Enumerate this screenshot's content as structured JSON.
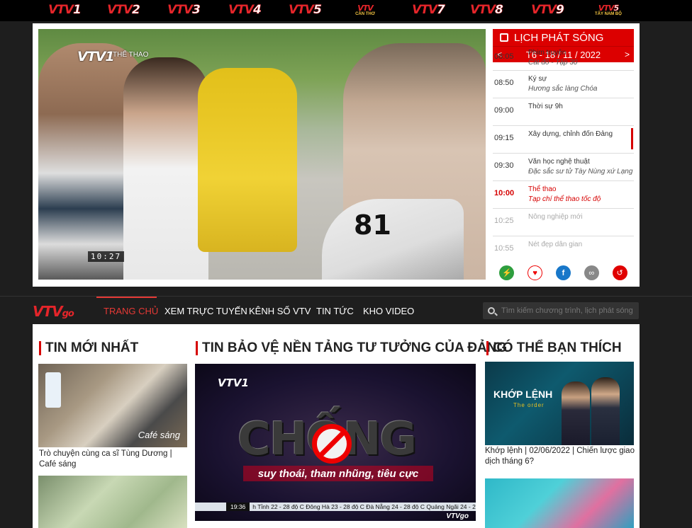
{
  "channels": [
    {
      "name": "VTV",
      "num": "1",
      "sub": ""
    },
    {
      "name": "VTV",
      "num": "2",
      "sub": ""
    },
    {
      "name": "VTV",
      "num": "3",
      "sub": ""
    },
    {
      "name": "VTV",
      "num": "4",
      "sub": ""
    },
    {
      "name": "VTV",
      "num": "5",
      "sub": ""
    },
    {
      "name": "VTV",
      "num": "",
      "sub": "CẦN THƠ"
    },
    {
      "name": "VTV",
      "num": "7",
      "sub": ""
    },
    {
      "name": "VTV",
      "num": "8",
      "sub": ""
    },
    {
      "name": "VTV",
      "num": "9",
      "sub": ""
    },
    {
      "name": "VTV",
      "num": "5",
      "sub": "TÂY NAM BỘ"
    }
  ],
  "player": {
    "logo": "VTV1",
    "logo_sub": "THỂ THAO",
    "time": "10:27",
    "car_number": "81"
  },
  "schedule": {
    "title": "LỊCH PHÁT SÓNG",
    "date": "T6 - 18 / 11 / 2022",
    "prev": "<",
    "next": ">",
    "items": [
      {
        "time": "08:05",
        "title": "Phim truyện",
        "sub": "Cát đỏ - Tập 30",
        "state": "past"
      },
      {
        "time": "08:50",
        "title": "Ký sự",
        "sub": "Hương sắc làng Chóa",
        "state": "past"
      },
      {
        "time": "09:00",
        "title": "Thời sự 9h",
        "sub": "",
        "state": "past"
      },
      {
        "time": "09:15",
        "title": "Xây dựng, chỉnh đốn Đảng",
        "sub": "",
        "state": "past"
      },
      {
        "time": "09:30",
        "title": "Văn học nghệ thuật",
        "sub": "Đặc sắc sư tử Tày Nùng xứ Lạng",
        "state": "past"
      },
      {
        "time": "10:00",
        "title": "Thể thao",
        "sub": "Tạp chí thể thao tốc độ",
        "state": "live"
      },
      {
        "time": "10:25",
        "title": "Nông nghiệp mới",
        "sub": "",
        "state": "future"
      },
      {
        "time": "10:55",
        "title": "Nét đẹp dân gian",
        "sub": "",
        "state": "future"
      }
    ]
  },
  "actions": [
    {
      "icon": "⚡",
      "color": "#2e9e3e"
    },
    {
      "icon": "♥",
      "color": "#ffffff"
    },
    {
      "icon": "f",
      "color": "#1877c9"
    },
    {
      "icon": "∞",
      "color": "#888888"
    },
    {
      "icon": "↺",
      "color": "#e00000"
    }
  ],
  "nav": {
    "logo": "VTV",
    "logo_go": "go",
    "items": [
      "TRANG CHỦ",
      "XEM TRỰC TUYẾN",
      "KÊNH SỐ VTV",
      "TIN TỨC",
      "KHO VIDEO"
    ],
    "search_placeholder": "Tìm kiếm chương trình, lịch phát sóng"
  },
  "sections": {
    "latest": {
      "title": "TIN MỚI NHẤT",
      "item1_caption": "Trò chuyện cùng ca sĩ Tùng Dương | Café sáng",
      "item1_overlay": "Café sáng"
    },
    "featured": {
      "title": "TIN BẢO VỆ NỀN TẢNG TƯ TƯỞNG CỦA ĐẢNG",
      "logo": "VTV1",
      "big_text": "CHỐNG",
      "banner": "suy thoái, tham nhũng, tiêu cực",
      "clock": "19:36",
      "ticker": "h Tỉnh 22 - 28 độ C Đông Hà 23 - 28 độ C Đà Nẵng 24 - 28 độ C Quảng Ngãi 24 - 28 độ C",
      "watermark": "VTVgo"
    },
    "suggest": {
      "title": "CÓ THỂ BẠN THÍCH",
      "thumb_title": "KHỚP LỆNH",
      "thumb_sub": "The order",
      "caption": "Khớp lệnh | 02/06/2022 | Chiến lược giao dịch tháng 6?"
    }
  }
}
